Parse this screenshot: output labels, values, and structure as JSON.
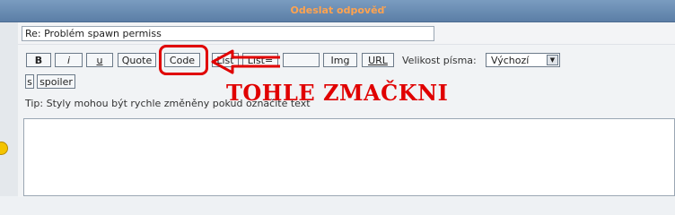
{
  "header": {
    "title": "Odeslat odpověď"
  },
  "subject": {
    "value": "Re: Problém spawn permiss"
  },
  "toolbar": {
    "bold": "B",
    "italic": "i",
    "underline": "u",
    "quote": "Quote",
    "code": "Code",
    "list": "List",
    "list_ordered": "List=",
    "img": "Img",
    "url": "URL",
    "s": "s",
    "spoiler": "spoiler"
  },
  "font_size": {
    "label": "Velikost písma:",
    "selected": "Výchozí"
  },
  "tip": "Tip: Styly mohou být rychle změněny pokud označíte text",
  "annotation": {
    "text": "TOHLE ZMAČKNI",
    "color": "#e00000"
  },
  "colors": {
    "header": "#5b7ea6",
    "header_text": "#ffa34f",
    "annotation": "#e00000"
  }
}
